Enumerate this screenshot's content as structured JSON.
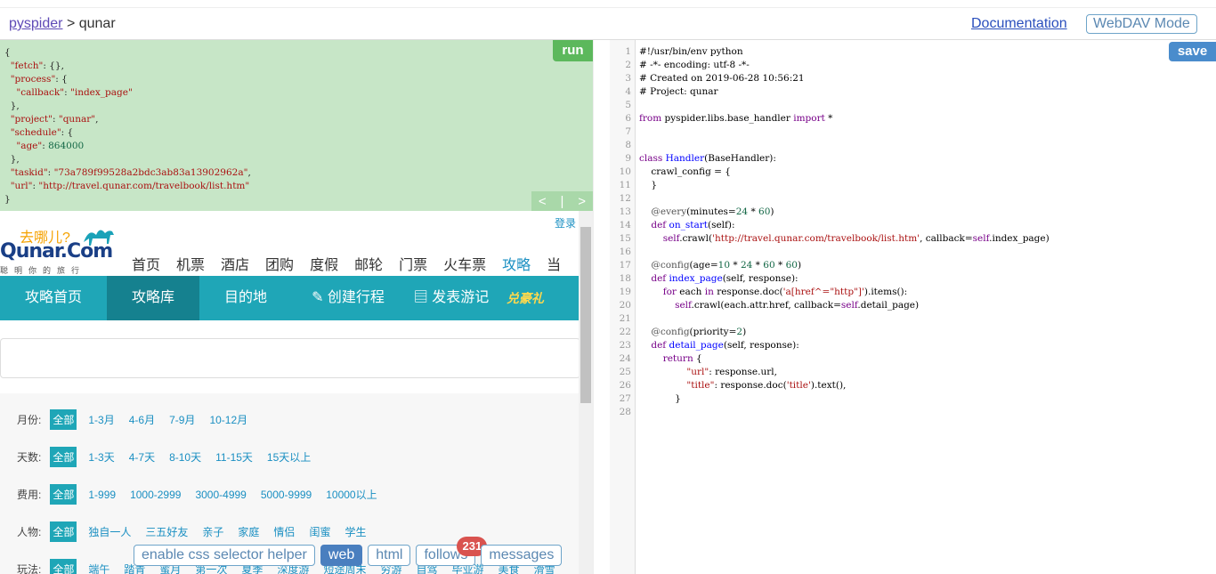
{
  "topbar": {
    "crumb_root": "pyspider",
    "crumb_sep": ">",
    "crumb_project": "qunar",
    "documentation": "Documentation",
    "webdav": "WebDAV Mode"
  },
  "task": {
    "run_label": "run",
    "prev": "<",
    "next": ">",
    "fetch_key": "\"fetch\"",
    "fetch_val": "{}",
    "process_key": "\"process\"",
    "callback_key": "\"callback\"",
    "callback_val": "\"index_page\"",
    "project_key": "\"project\"",
    "project_val": "\"qunar\"",
    "schedule_key": "\"schedule\"",
    "age_key": "\"age\"",
    "age_val": "864000",
    "taskid_key": "\"taskid\"",
    "taskid_val": "\"73a789f99528a2bdc3ab83a13902962a\"",
    "url_key": "\"url\"",
    "url_val": "\"http://travel.qunar.com/travelbook/list.htm\""
  },
  "web": {
    "login": "登录",
    "logo_tag": "去哪儿?",
    "logo_name": "Qunar.Com",
    "logo_slogan": "聪明你的旅行",
    "main_nav": [
      "首页",
      "机票",
      "酒店",
      "团购",
      "度假",
      "邮轮",
      "门票",
      "火车票",
      "攻略",
      "当"
    ],
    "main_nav_active": "攻略",
    "sub_nav": [
      "攻略首页",
      "攻略库",
      "目的地",
      "创建行程",
      "发表游记"
    ],
    "gift": "兑豪礼",
    "filters": [
      {
        "label": "月份:",
        "all": "全部",
        "options": [
          "1-3月",
          "4-6月",
          "7-9月",
          "10-12月"
        ]
      },
      {
        "label": "天数:",
        "all": "全部",
        "options": [
          "1-3天",
          "4-7天",
          "8-10天",
          "11-15天",
          "15天以上"
        ]
      },
      {
        "label": "费用:",
        "all": "全部",
        "options": [
          "1-999",
          "1000-2999",
          "3000-4999",
          "5000-9999",
          "10000以上"
        ]
      },
      {
        "label": "人物:",
        "all": "全部",
        "options": [
          "独自一人",
          "三五好友",
          "亲子",
          "家庭",
          "情侣",
          "闺蜜",
          "学生"
        ]
      },
      {
        "label": "玩法:",
        "all": "全部",
        "options": [
          "端午",
          "踏青",
          "蜜月",
          "第一次",
          "夏季",
          "深度游",
          "短途周末",
          "穷游",
          "自驾",
          "毕业游",
          "美食",
          "滑雪"
        ]
      }
    ]
  },
  "helpers": {
    "css": "enable css selector helper",
    "web": "web",
    "html": "html",
    "follows": "follows",
    "follows_count": "231",
    "messages": "messages"
  },
  "editor": {
    "save": "save",
    "line_numbers": [
      "1",
      "2",
      "3",
      "4",
      "5",
      "6",
      "7",
      "8",
      "9",
      "10",
      "11",
      "12",
      "13",
      "14",
      "15",
      "16",
      "17",
      "18",
      "19",
      "20",
      "21",
      "22",
      "23",
      "24",
      "25",
      "26",
      "27",
      "28"
    ],
    "l1": "#!/usr/bin/env python",
    "l2": "# -*- encoding: utf-8 -*-",
    "l3": "# Created on 2019-06-28 10:56:21",
    "l4": "# Project: qunar",
    "l6a": "from",
    "l6b": " pyspider.libs.base_handler ",
    "l6c": "import",
    "l6d": " *",
    "l9a": "class",
    "l9b": "Handler",
    "l9c": "(BaseHandler):",
    "l10": "    crawl_config = {",
    "l11": "    }",
    "l13a": "    @every",
    "l13b": "(minutes=",
    "l13c": "24",
    "l13d": " * ",
    "l13e": "60",
    "l13f": ")",
    "l14a": "def",
    "l14b": "on_start",
    "l14c": "(self):",
    "l15a": "self",
    "l15b": ".crawl(",
    "l15c": "'http://travel.qunar.com/travelbook/list.htm'",
    "l15d": ", callback=",
    "l15e": "self",
    "l15f": ".index_page)",
    "l17a": "    @config",
    "l17b": "(age=",
    "l17c": "10",
    "l17d": " * ",
    "l17e": "24",
    "l17f": " * ",
    "l17g": "60",
    "l17h": " * ",
    "l17i": "60",
    "l17j": ")",
    "l18a": "def",
    "l18b": "index_page",
    "l18c": "(self, response):",
    "l19a": "for",
    "l19b": " each ",
    "l19c": "in",
    "l19d": " response.doc(",
    "l19e": "'a[href^=\"http\"]'",
    "l19f": ").items():",
    "l20a": "self",
    "l20b": ".crawl(each.attr.href, callback=",
    "l20c": "self",
    "l20d": ".detail_page)",
    "l22a": "    @config",
    "l22b": "(priority=",
    "l22c": "2",
    "l22d": ")",
    "l23a": "def",
    "l23b": "detail_page",
    "l23c": "(self, response):",
    "l24a": "return",
    "l24b": " {",
    "l25a": "\"url\"",
    "l25b": ": response.url,",
    "l26a": "\"title\"",
    "l26b": ": response.doc(",
    "l26c": "'title'",
    "l26d": ").text(),",
    "l27": "}"
  }
}
